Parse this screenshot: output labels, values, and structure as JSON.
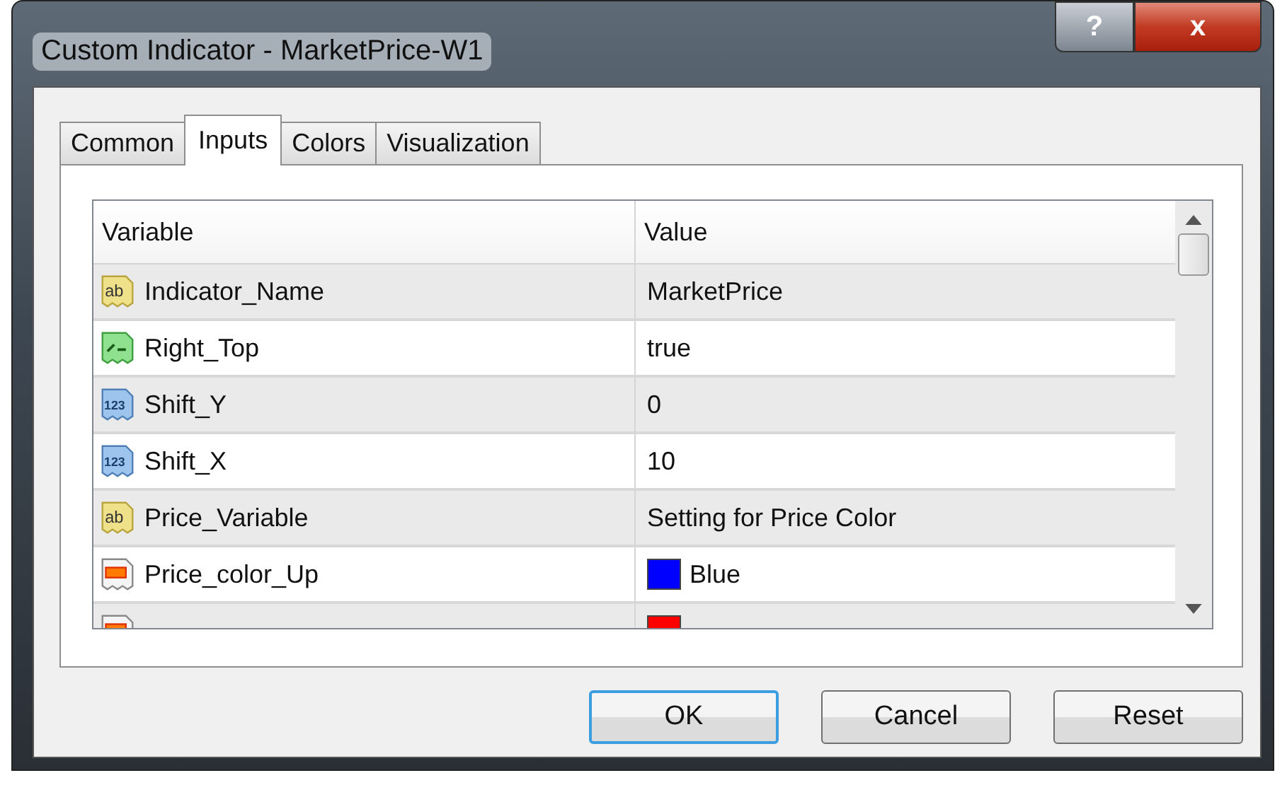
{
  "window": {
    "title": "Custom Indicator - MarketPrice-W1",
    "help_button": "?",
    "close_button": "x"
  },
  "tabs": [
    {
      "label": "Common",
      "selected": false
    },
    {
      "label": "Inputs",
      "selected": true
    },
    {
      "label": "Colors",
      "selected": false
    },
    {
      "label": "Visualization",
      "selected": false
    }
  ],
  "table": {
    "columns": [
      "Variable",
      "Value"
    ],
    "rows": [
      {
        "kind": "string",
        "icon_label": "ab",
        "variable": "Indicator_Name",
        "value": "MarketPrice"
      },
      {
        "kind": "bool",
        "variable": "Right_Top",
        "value": "true"
      },
      {
        "kind": "int",
        "icon_label": "123",
        "variable": "Shift_Y",
        "value": "0"
      },
      {
        "kind": "int",
        "icon_label": "123",
        "variable": "Shift_X",
        "value": "10"
      },
      {
        "kind": "string",
        "icon_label": "ab",
        "variable": "Price_Variable",
        "value": "Setting for Price Color"
      },
      {
        "kind": "color",
        "variable": "Price_color_Up",
        "value": "Blue",
        "color": "#0000ff"
      },
      {
        "kind": "color",
        "color": "#ff0000"
      }
    ]
  },
  "buttons": [
    {
      "label": "OK",
      "default": true
    },
    {
      "label": "Cancel",
      "default": false
    },
    {
      "label": "Reset",
      "default": false
    }
  ]
}
